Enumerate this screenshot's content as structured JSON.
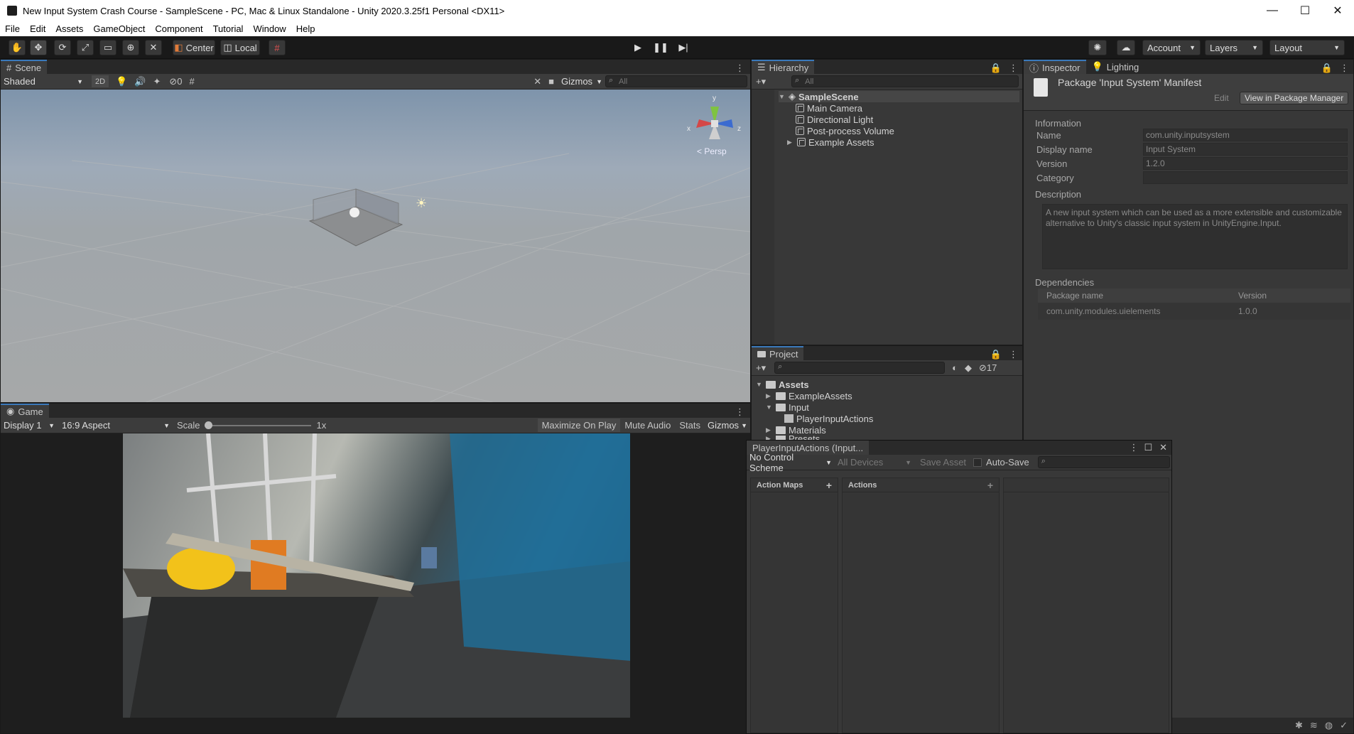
{
  "window": {
    "title": "New Input System Crash Course - SampleScene - PC, Mac & Linux Standalone - Unity 2020.3.25f1 Personal <DX11>",
    "minimize": "—",
    "maximize": "☐",
    "close": "✕"
  },
  "menu": [
    "File",
    "Edit",
    "Assets",
    "GameObject",
    "Component",
    "Tutorial",
    "Window",
    "Help"
  ],
  "toolbar": {
    "pivot": "Center",
    "space": "Local",
    "account": "Account",
    "layers": "Layers",
    "layout": "Layout"
  },
  "scene": {
    "tab": "Scene",
    "shading": "Shaded",
    "mode2d": "2D",
    "hidden_count": "0",
    "gizmos": "Gizmos",
    "search_placeholder": "All",
    "persp": "< Persp",
    "axis_y": "y",
    "axis_x": "x",
    "axis_z": "z"
  },
  "game": {
    "tab": "Game",
    "display": "Display 1",
    "aspect": "16:9 Aspect",
    "scale_label": "Scale",
    "scale_value": "1x",
    "maximize": "Maximize On Play",
    "mute": "Mute Audio",
    "stats": "Stats",
    "gizmos": "Gizmos"
  },
  "hierarchy": {
    "tab": "Hierarchy",
    "search_placeholder": "All",
    "scene": "SampleScene",
    "items": [
      "Main Camera",
      "Directional Light",
      "Post-process Volume",
      "Example Assets"
    ]
  },
  "project": {
    "tab": "Project",
    "hidden_count": "17",
    "root": "Assets",
    "items": [
      "ExampleAssets",
      "Input",
      "PlayerInputActions",
      "Materials",
      "Presets"
    ]
  },
  "inspector": {
    "tab": "Inspector",
    "tab2": "Lighting",
    "header": "Package 'Input System' Manifest",
    "edit": "Edit",
    "view_pm": "View in Package Manager",
    "information": "Information",
    "fields": [
      {
        "key": "Name",
        "value": "com.unity.inputsystem"
      },
      {
        "key": "Display name",
        "value": "Input System"
      },
      {
        "key": "Version",
        "value": "1.2.0"
      },
      {
        "key": "Category",
        "value": ""
      }
    ],
    "description_label": "Description",
    "description": "A new input system which can be used as a more extensible and customizable alternative to Unity's classic input system in UnityEngine.Input.",
    "dependencies_label": "Dependencies",
    "dep_col1": "Package name",
    "dep_col2": "Version",
    "dep_name": "com.unity.modules.uielements",
    "dep_version": "1.0.0"
  },
  "input_actions": {
    "title": "PlayerInputActions (Input...",
    "control_scheme": "No Control Scheme",
    "devices": "All Devices",
    "save_asset": "Save Asset",
    "auto_save": "Auto-Save",
    "action_maps": "Action Maps",
    "actions": "Actions"
  },
  "colors": {
    "accent": "#3a79bb",
    "panel": "#383838",
    "dark": "#191919"
  }
}
